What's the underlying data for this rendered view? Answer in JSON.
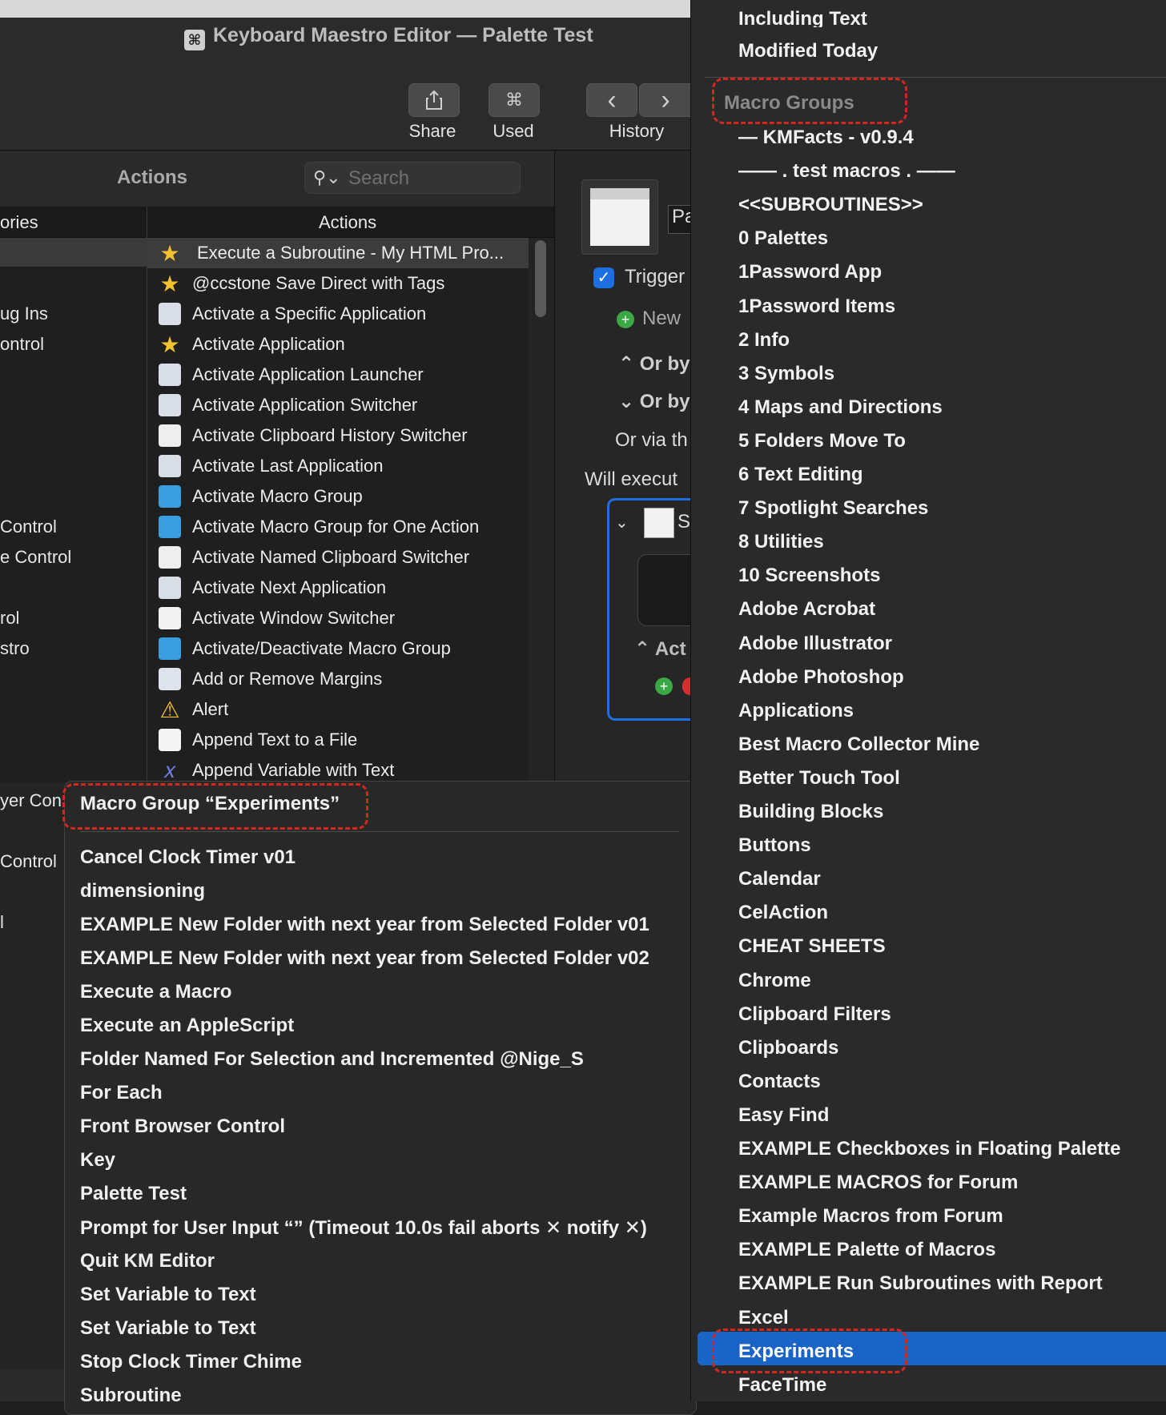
{
  "window": {
    "title": "Keyboard Maestro Editor — Palette Test"
  },
  "toolbar": {
    "share_label": "Share",
    "used_label": "Used",
    "history_label": "History",
    "used_icon": "⌘",
    "back_icon": "‹",
    "forward_icon": "›"
  },
  "actions_panel": {
    "title": "Actions",
    "search_placeholder": "Search",
    "col_categories": "ories",
    "col_actions": "Actions",
    "categories": [
      "ug Ins",
      "ontrol",
      "Control",
      "e Control",
      "rol",
      "stro",
      "yer Con",
      "Control",
      "l"
    ],
    "actions": [
      {
        "label": "Execute a Subroutine - My HTML Pro...",
        "icon": "star-icon"
      },
      {
        "label": "@ccstone Save Direct with Tags",
        "icon": "star-icon"
      },
      {
        "label": "Activate a Specific Application",
        "icon": "app-icon"
      },
      {
        "label": "Activate Application",
        "icon": "star-icon"
      },
      {
        "label": "Activate Application Launcher",
        "icon": "app-icon"
      },
      {
        "label": "Activate Application Switcher",
        "icon": "app-icon"
      },
      {
        "label": "Activate Clipboard History Switcher",
        "icon": "clipboard-icon"
      },
      {
        "label": "Activate Last Application",
        "icon": "app-icon"
      },
      {
        "label": "Activate Macro Group",
        "icon": "folder-icon"
      },
      {
        "label": "Activate Macro Group for One Action",
        "icon": "folder-icon"
      },
      {
        "label": "Activate Named Clipboard Switcher",
        "icon": "clipboard-icon"
      },
      {
        "label": "Activate Next Application",
        "icon": "app-icon"
      },
      {
        "label": "Activate Window Switcher",
        "icon": "window-icon"
      },
      {
        "label": "Activate/Deactivate Macro Group",
        "icon": "folder-icon"
      },
      {
        "label": "Add or Remove Margins",
        "icon": "margins-icon"
      },
      {
        "label": "Alert",
        "icon": "warning-icon"
      },
      {
        "label": "Append Text to a File",
        "icon": "file-icon"
      },
      {
        "label": "Append Variable with Text",
        "icon": "variable-icon"
      }
    ]
  },
  "macro_pane": {
    "name_field": "Pa",
    "trigger_label": "Trigger",
    "new_label": "New",
    "or_by_1": "Or by",
    "or_by_2": "Or by",
    "or_via": "Or via th",
    "will_execute": "Will execut",
    "action_label": "Act",
    "s_label": "S"
  },
  "popup_menu": {
    "header": "Macro Group “Experiments”",
    "items": [
      "Cancel Clock Timer v01",
      "dimensioning",
      "EXAMPLE New Folder with next year from Selected Folder v01",
      "EXAMPLE New Folder with next year from Selected Folder v02",
      "Execute a Macro",
      "Execute an AppleScript",
      "Folder Named For Selection and Incremented @Nige_S",
      "For Each",
      "Front Browser Control",
      "Key",
      "Palette Test",
      "Prompt for User Input “” (Timeout 10.0s fail aborts ✕ notify ✕)",
      "Quit KM Editor",
      "Set Variable to Text",
      "Set Variable to Text",
      "Stop Clock Timer Chime",
      "Subroutine"
    ]
  },
  "right_menu": {
    "top_items": [
      "Including Text",
      "Modified Today"
    ],
    "section_title": "Macro Groups",
    "groups": [
      "— KMFacts - v0.9.4",
      "—— . test macros . ——",
      "<<SUBROUTINES>>",
      "0 Palettes",
      "1Password App",
      "1Password Items",
      "2 Info",
      "3 Symbols",
      "4 Maps and Directions",
      "5 Folders Move To",
      "6 Text Editing",
      "7 Spotlight Searches",
      "8 Utilities",
      "10 Screenshots",
      "Adobe Acrobat",
      "Adobe Illustrator",
      "Adobe Photoshop",
      "Applications",
      "Best Macro Collector Mine",
      "Better Touch Tool",
      "Building Blocks",
      "Buttons",
      "Calendar",
      "CelAction",
      "CHEAT SHEETS",
      "Chrome",
      "Clipboard Filters",
      "Clipboards",
      "Contacts",
      "Easy Find",
      "EXAMPLE Checkboxes in Floating Palette",
      "EXAMPLE MACROS for Forum",
      "Example Macros from Forum",
      "EXAMPLE Palette of Macros",
      "EXAMPLE Run Subroutines with Report",
      "Excel",
      "Experiments",
      "FaceTime"
    ],
    "selected": "Experiments"
  },
  "colors": {
    "highlight_dash": "#d1281f",
    "selection_blue": "#1a64c8",
    "checkbox_blue": "#1d6fe0"
  }
}
